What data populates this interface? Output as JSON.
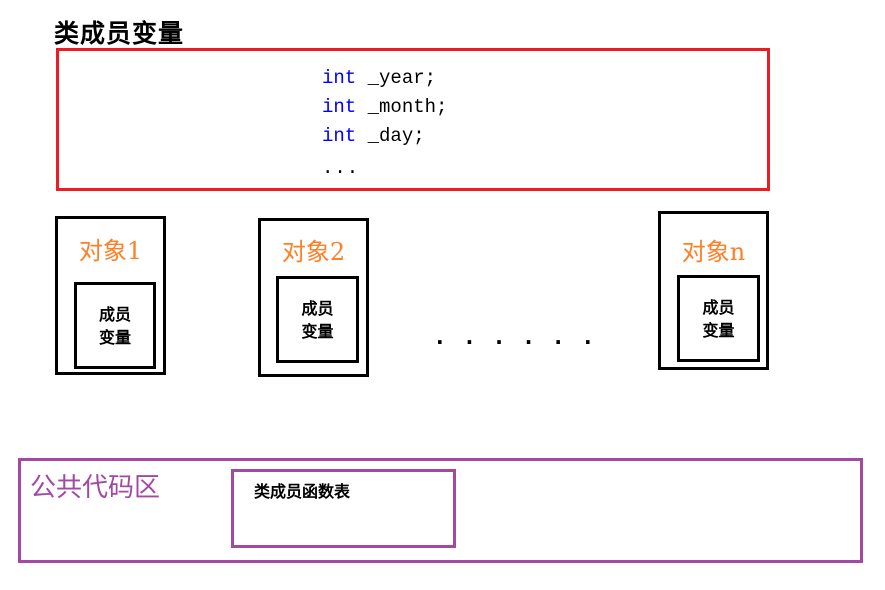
{
  "title": "类成员变量",
  "members": {
    "lines": [
      {
        "keyword": "int",
        "name": " _year;"
      },
      {
        "keyword": "int",
        "name": " _month;"
      },
      {
        "keyword": "int",
        "name": " _day;"
      }
    ],
    "ellipsis": "..."
  },
  "objects": [
    {
      "title": "对象1",
      "inner_line1": "成员",
      "inner_line2": "变量"
    },
    {
      "title": "对象2",
      "inner_line1": "成员",
      "inner_line2": "变量"
    },
    {
      "title": "对象n",
      "inner_line1": "成员",
      "inner_line2": "变量"
    }
  ],
  "dots": "······",
  "common_area": {
    "title": "公共代码区",
    "function_table": "类成员函数表"
  },
  "colors": {
    "member_box": "#ed1c24",
    "object_title": "#ff7f27",
    "keyword": "#0000ff",
    "common_area": "#a349a4"
  }
}
